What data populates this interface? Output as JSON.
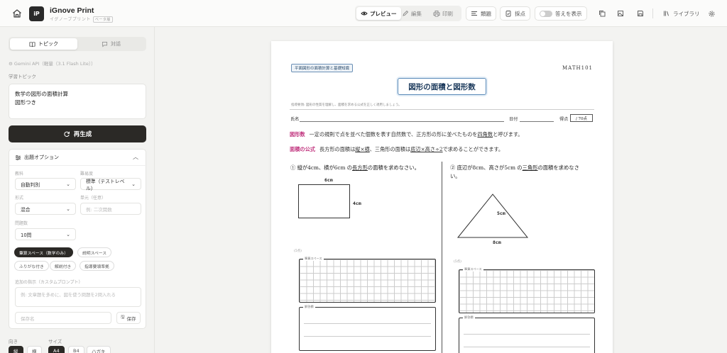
{
  "header": {
    "app_title": "iGnove Print",
    "app_subtitle": "イグノーブプリント",
    "app_version": "ベータ版",
    "logo_text": "iP",
    "view_tabs": [
      {
        "label": "プレビュー",
        "active": true
      },
      {
        "label": "編集",
        "active": false
      },
      {
        "label": "印刷",
        "active": false
      }
    ],
    "buttons": {
      "problems": "類題",
      "grading": "採点",
      "show_answers": "答えを表示",
      "library": "ライブラリ"
    }
  },
  "sidebar": {
    "tabs": [
      {
        "label": "トピック",
        "active": true
      },
      {
        "label": "対話",
        "active": false
      }
    ],
    "api_info": "Gemini API（軽量（3.1 Flash Lite））",
    "topic_label": "学習トピック",
    "topic_lines": [
      "数学の図形の面積計算",
      "図形つき"
    ],
    "regenerate": "再生成",
    "options": {
      "title": "出題オプション",
      "subject_label": "教科",
      "subject_value": "自動判別",
      "difficulty_label": "難易度",
      "difficulty_value": "標準（テストレベル）",
      "format_label": "形式",
      "format_value": "混合",
      "unit_label": "単元（任意）",
      "unit_placeholder": "例: 二次関数",
      "count_label": "問題数",
      "count_value": "10問",
      "chips": [
        {
          "label": "筆算スペース（数学のみ）",
          "on": true
        },
        {
          "label": "説明スペース",
          "on": false
        },
        {
          "label": "ふりがな付き",
          "on": false
        },
        {
          "label": "解説付き",
          "on": false
        },
        {
          "label": "指導要領準拠",
          "on": false
        }
      ],
      "extra_label": "追加の指示（カスタムプロンプト）",
      "extra_placeholder": "例: 文章題を多めに、図を使う問題を2問入れる",
      "save_name_placeholder": "保存名",
      "save_button": "保存"
    },
    "orientation_label": "向き",
    "orientation_options": [
      {
        "label": "縦",
        "on": true
      },
      {
        "label": "横",
        "on": false
      }
    ],
    "size_label": "サイズ",
    "size_options": [
      {
        "label": "A4",
        "on": true
      },
      {
        "label": "B4",
        "on": false
      },
      {
        "label": "ハガキ",
        "on": false
      }
    ]
  },
  "paper": {
    "tag": "平面図形の面積計算と基礎知識",
    "code": "MATH101",
    "title": "図形の面積と図形数",
    "instruction": "指導要領: 図形の性質を理解し、面積を求める公式を正しく適用しましょう。",
    "name_label": "氏名",
    "date_label": "日付",
    "score_label": "得点",
    "score_value": "/ 70点",
    "term1": {
      "key": "図形数",
      "pre": "一定の規則で点を並べた個数を表す自然数で、正方形の形に並べたものを",
      "u": "四角数",
      "post": "と呼びます。"
    },
    "term2": {
      "key": "面積の公式",
      "pre": "長方形の面積は",
      "u1": "縦×横",
      "mid": "、三角形の面積は",
      "u2": "底辺×高さ÷2",
      "post": "で求めることができます。"
    },
    "q1": {
      "pre": "① 縦が4cm、横が6cm の",
      "u": "長方形",
      "post": "の面積を求めなさい。"
    },
    "q2": {
      "pre": "② 底辺が8cm、高さが5cm の",
      "u": "三角形",
      "post": "の面積を求めなさ",
      "line2": "い。"
    },
    "fig1": {
      "width_label": "6cm",
      "height_label": "4cm"
    },
    "fig2": {
      "height_label": "5cm",
      "base_label": "8cm"
    },
    "points": "(5点)",
    "work_label": "筆算スペース",
    "answer_label": "解答欄"
  }
}
